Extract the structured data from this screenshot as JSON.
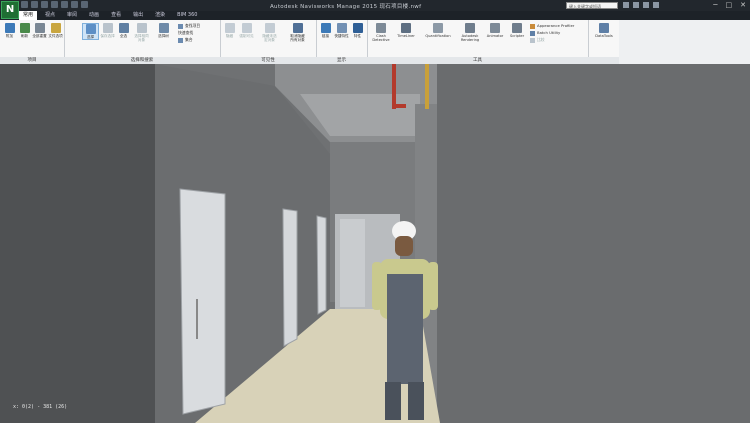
{
  "app": {
    "logo_letter": "N",
    "window_title": "Autodesk Navisworks Manage 2015    现石项目楼.nwf",
    "search_placeholder": "键入关键字或短语"
  },
  "tabs": [
    "常用",
    "视点",
    "审阅",
    "动画",
    "查看",
    "输出",
    "渲染",
    "BIM 360"
  ],
  "ribbon": {
    "project": {
      "label": "项目",
      "tools": [
        "附加",
        "刷新",
        "全部重置",
        "文件选项"
      ]
    },
    "select": {
      "label": "选择和搜索",
      "tools": [
        "选择",
        "保存选择",
        "全选",
        "选择相同对象",
        "选择树"
      ],
      "small": [
        "查找项目",
        "快速查找",
        "集合"
      ]
    },
    "visibility": {
      "label": "可见性",
      "tools": [
        "隐藏",
        "强制可见",
        "隐藏未选定对象",
        "取消隐藏所有对象"
      ]
    },
    "display": {
      "label": "显示",
      "tools": [
        "链接",
        "快捷特性",
        "特性"
      ]
    },
    "tools_panel": {
      "label": "工具",
      "tools": [
        "Clash Detective",
        "TimeLiner",
        "Quantification",
        "Autodesk Rendering",
        "Animator",
        "Scripter"
      ],
      "small": [
        "Appearance Profiler",
        "Batch Utility",
        "比较"
      ]
    },
    "datatools": {
      "tools": [
        "DataTools"
      ]
    }
  },
  "viewport": {
    "coordinates": "x: 0(2) - 381 (26)"
  },
  "colors": {
    "accent": "#1f6e33",
    "ribbon_bg": "#f7f7f7",
    "titlebar_bg": "#22272d"
  }
}
